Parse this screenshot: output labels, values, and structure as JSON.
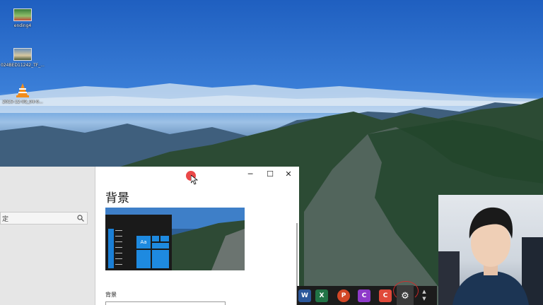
{
  "desktop": {
    "icons": [
      {
        "label": "ending4",
        "icon": "image-icon"
      },
      {
        "label": "024BED11242_TF_...",
        "icon": "image-icon"
      },
      {
        "label": "2015-12-09_04-0...",
        "icon": "vlc-icon"
      }
    ]
  },
  "left_panel": {
    "search_placeholder": "定"
  },
  "settings_window": {
    "title": "背景",
    "preview_tile_text": "Aa",
    "section_label": "背景",
    "controls": {
      "minimize": "─",
      "maximize": "☐",
      "close": "✕"
    }
  },
  "taskbar": {
    "apps": [
      {
        "name": "word",
        "glyph": "W",
        "color": "#2b579a"
      },
      {
        "name": "excel",
        "glyph": "X",
        "color": "#217346"
      },
      {
        "name": "powerpoint",
        "glyph": "P",
        "color": "#d24726"
      },
      {
        "name": "app-purple",
        "glyph": "C",
        "color": "#8e3ac9"
      },
      {
        "name": "app-red",
        "glyph": "C",
        "color": "#e04a3a"
      },
      {
        "name": "settings",
        "glyph": "⚙",
        "color": "#3b3b3b"
      }
    ]
  }
}
